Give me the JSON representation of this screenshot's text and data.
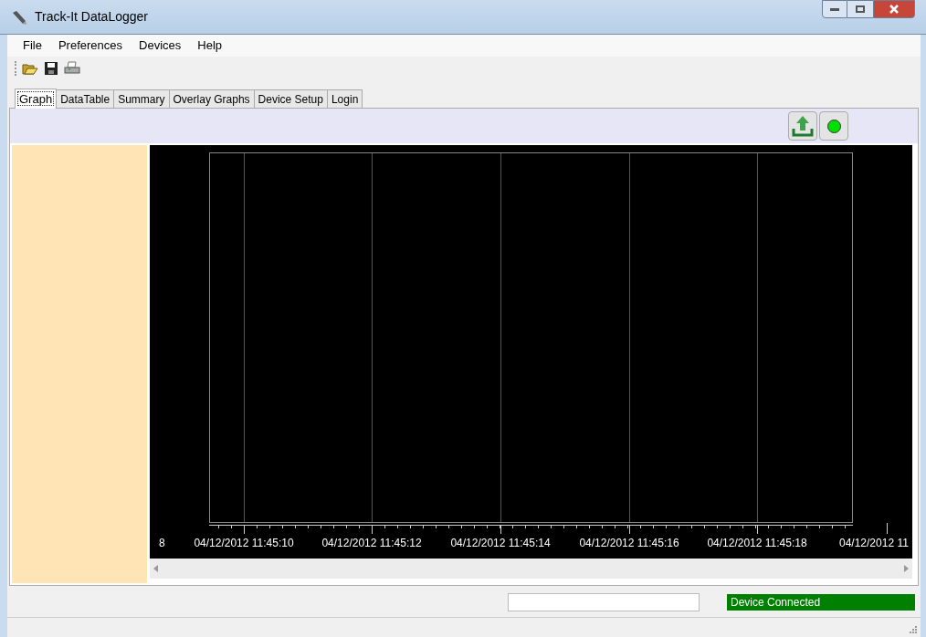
{
  "window": {
    "title": "Track-It DataLogger"
  },
  "menu": [
    "File",
    "Preferences",
    "Devices",
    "Help"
  ],
  "tabs": [
    {
      "label": "Graph",
      "selected": true
    },
    {
      "label": "DataTable",
      "selected": false
    },
    {
      "label": "Summary",
      "selected": false
    },
    {
      "label": "Overlay Graphs",
      "selected": false
    },
    {
      "label": "Device Setup",
      "selected": false
    },
    {
      "label": "Login",
      "selected": false
    }
  ],
  "graph": {
    "x_labels": [
      "8",
      "04/12/2012 11:45:10",
      "04/12/2012 11:45:12",
      "04/12/2012 11:45:14",
      "04/12/2012 11:45:16",
      "04/12/2012 11:45:18",
      "04/12/2012 11"
    ]
  },
  "status_bar": {
    "status": "Device Connected",
    "connected": true
  }
}
